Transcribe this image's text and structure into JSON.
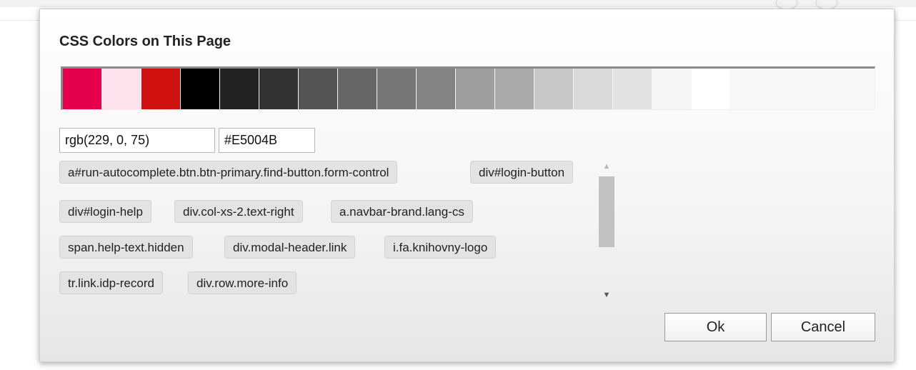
{
  "dialog": {
    "title": "CSS Colors on This Page"
  },
  "swatches": [
    "#E5004B",
    "#FDE2EE",
    "#CF1110",
    "#000000",
    "#222222",
    "#323232",
    "#555555",
    "#666666",
    "#767676",
    "#838383",
    "#9E9E9E",
    "#A9A9A9",
    "#C8C8C8",
    "#D9D9D9",
    "#E2E2E2",
    "#F5F5F5",
    "#FFFFFF"
  ],
  "selected": {
    "rgb": "rgb(229, 0, 75)",
    "hex": "#E5004B"
  },
  "tags": [
    "a#run-autocomplete.btn.btn-primary.find-button.form-control",
    "div#login-button",
    "div#login-help",
    "div.col-xs-2.text-right",
    "a.navbar-brand.lang-cs",
    "span.help-text.hidden",
    "div.modal-header.link",
    "i.fa.knihovny-logo",
    "tr.link.idp-record",
    "div.row.more-info"
  ],
  "buttons": {
    "ok": "Ok",
    "cancel": "Cancel"
  },
  "scrollbar": {
    "up_icon": "triangle-up-icon",
    "down_icon": "triangle-down-icon"
  }
}
